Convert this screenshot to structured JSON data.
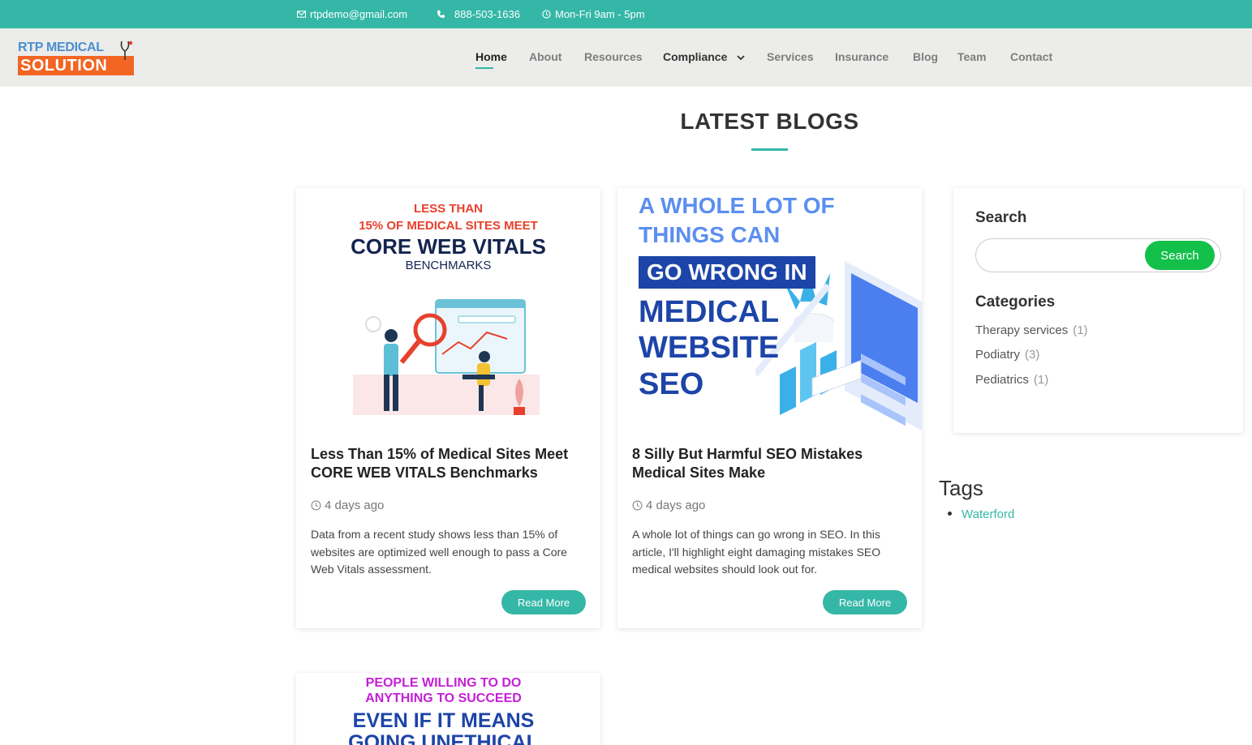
{
  "topbar": {
    "email": "rtpdemo@gmail.com",
    "phone": "888-503-1636",
    "hours": "Mon-Fri 9am - 5pm",
    "icons": [
      "mail-icon",
      "phone-icon",
      "clock-icon"
    ]
  },
  "logo": {
    "line1": "RTP MEDICAL",
    "line2": "SOLUTION"
  },
  "nav": {
    "items": [
      {
        "label": "Home"
      },
      {
        "label": "About"
      },
      {
        "label": "Resources"
      },
      {
        "label": "Compliance"
      },
      {
        "label": "Services"
      },
      {
        "label": "Insurance"
      },
      {
        "label": "Blog"
      },
      {
        "label": "Team"
      },
      {
        "label": "Contact"
      }
    ],
    "active": "Home"
  },
  "section": {
    "title": "LATEST BLOGS"
  },
  "posts": [
    {
      "image_text": [
        "LESS THAN",
        "15% OF MEDICAL SITES MEET",
        "CORE WEB VITALS",
        "BENCHMARKS"
      ],
      "title": "Less Than 15% of Medical Sites Meet CORE WEB VITALS Benchmarks",
      "date": "4 days ago",
      "excerpt": "Data from a recent study shows less than 15% of websites are optimized well enough to pass a Core Web Vitals assessment.",
      "button": "Read More"
    },
    {
      "image_text": [
        "A WHOLE LOT OF",
        "THINGS CAN",
        "GO WRONG IN",
        "MEDICAL",
        "WEBSITE",
        "SEO"
      ],
      "title": "8 Silly But Harmful SEO Mistakes Medical Sites Make",
      "date": "4 days ago",
      "excerpt": "A whole lot of things can go wrong in SEO. In this article, I'll highlight eight damaging mistakes SEO medical websites should look out for.",
      "button": "Read More"
    },
    {
      "image_text": [
        "PEOPLE WILLING TO DO",
        "ANYTHING TO SUCCEED",
        "EVEN IF IT MEANS",
        "GOING UNETHICAL"
      ]
    }
  ],
  "sidebar": {
    "search_title": "Search",
    "search_placeholder": "",
    "search_button": "Search",
    "categories_title": "Categories",
    "categories": [
      {
        "name": "Therapy services",
        "count": "(1)"
      },
      {
        "name": "Podiatry",
        "count": "(3)"
      },
      {
        "name": "Pediatrics",
        "count": "(1)"
      }
    ],
    "tags_title": "Tags",
    "tags": [
      "Waterford"
    ]
  },
  "colors": {
    "accent": "#34b7a7",
    "search_button": "#13c04a",
    "logo_orange": "#f26522",
    "logo_blue": "#4a8fd0"
  }
}
